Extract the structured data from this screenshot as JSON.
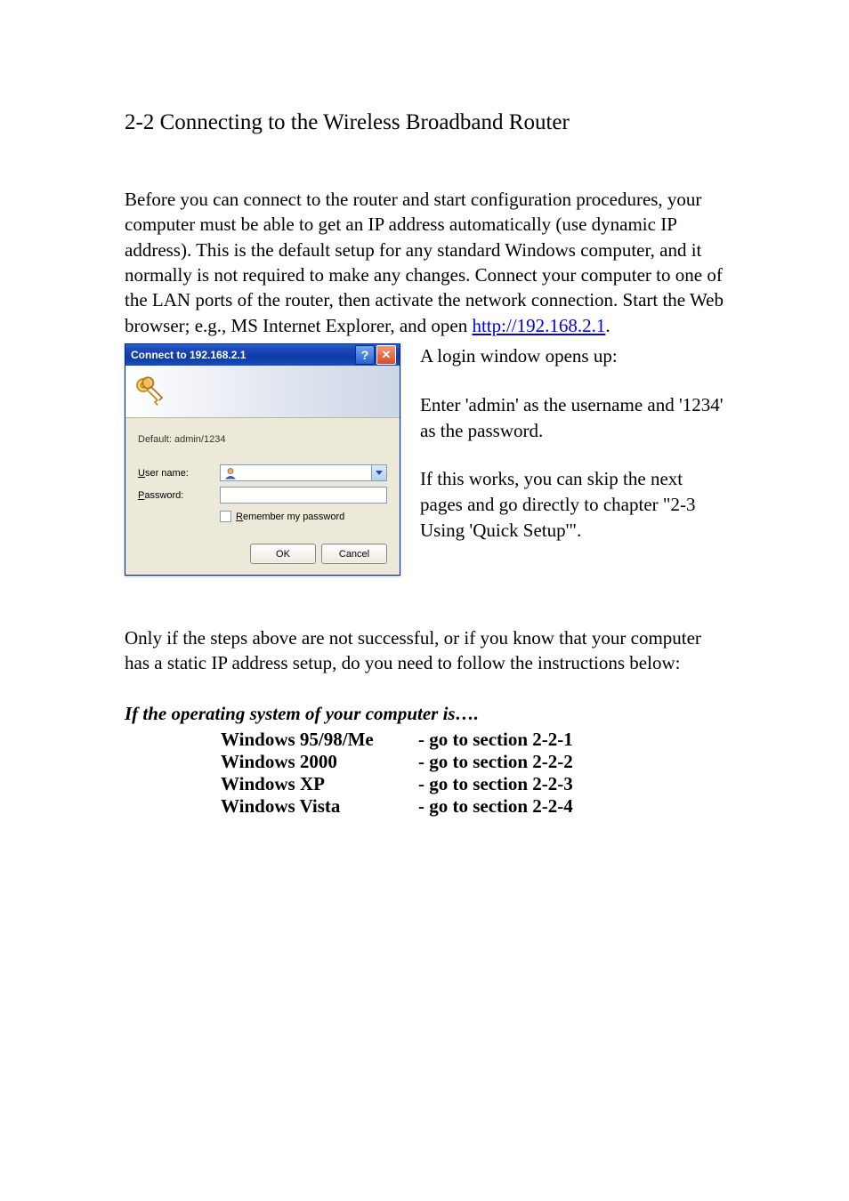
{
  "section": {
    "number": "2-2",
    "title": "Connecting to the Wireless Broadband Router"
  },
  "intro": {
    "text_before_link": "Before you can connect to the router and start configuration procedures, your computer must be able to get an IP address automatically (use dynamic IP address). This is the default setup for any standard Windows computer, and it normally is not required to make any changes. Connect your computer to one of the LAN ports of the router, then activate the network connection. Start the Web browser; e.g., MS Internet Explorer, and open ",
    "link_text": "http://192.168.2.1",
    "after_link": "."
  },
  "dialog": {
    "title": "Connect to 192.168.2.1",
    "default_hint": "Default: admin/1234",
    "user_label_pre": "U",
    "user_label_rest": "ser name:",
    "pwd_label_pre": "P",
    "pwd_label_rest": "assword:",
    "remember_pre": "R",
    "remember_rest": "emember my password",
    "ok": "OK",
    "cancel": "Cancel"
  },
  "side": {
    "p1": "A login window opens up:",
    "p2": "Enter 'admin' as the username and '1234' as the password.",
    "p3": "If this works, you can skip the next pages and go directly to chapter \"2-3 Using 'Quick Setup'\"."
  },
  "after_dialog": "Only if the steps above are not successful, or if you know that your computer has a static IP address setup, do you need to follow the instructions below:",
  "os_heading": "If the operating system of your computer is….",
  "os_list": [
    {
      "label": "Windows 95/98/Me",
      "ref": "- go to section 2-2-1"
    },
    {
      "label": "Windows 2000",
      "ref": "- go to section 2-2-2"
    },
    {
      "label": "Windows XP",
      "ref": "- go to section 2-2-3"
    },
    {
      "label": "Windows Vista",
      "ref": "- go to section 2-2-4"
    }
  ]
}
